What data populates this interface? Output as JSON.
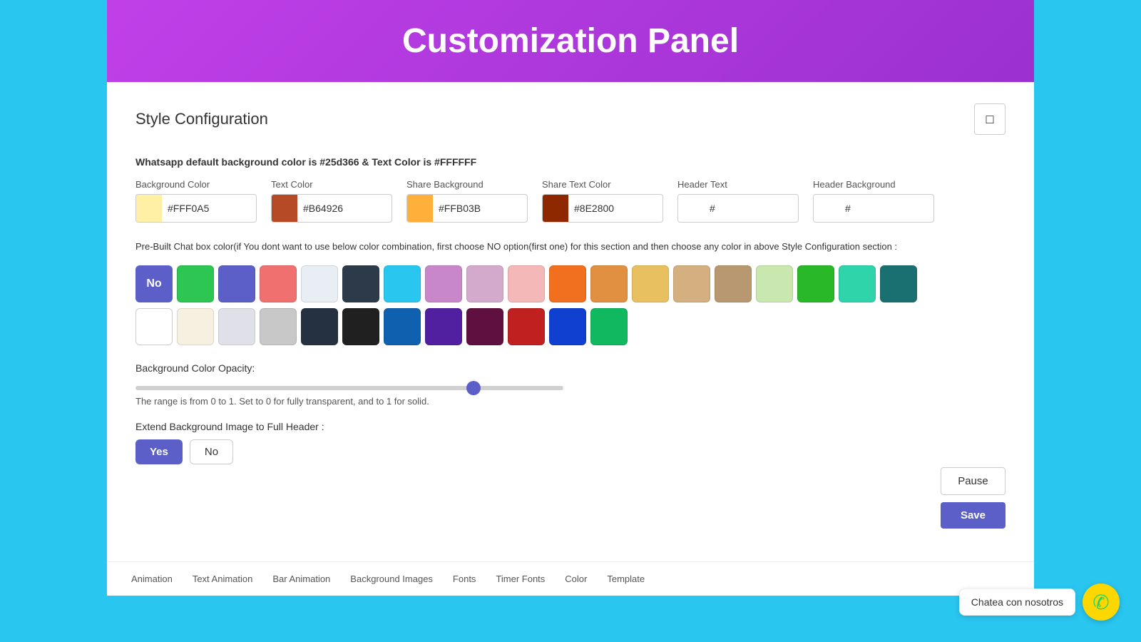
{
  "header": {
    "title": "Customization Panel",
    "bg_color": "#C040E8"
  },
  "panel": {
    "title": "Style Configuration",
    "device_icon": "□",
    "info_text": "Whatsapp default background color is #25d366 & Text Color is #FFFFFF",
    "fields": [
      {
        "label": "Background Color",
        "value": "#FFF0A5",
        "swatch": "#FFF0A5"
      },
      {
        "label": "Text Color",
        "value": "#B64926",
        "swatch": "#B64926"
      },
      {
        "label": "Share Background",
        "value": "#FFB03B",
        "swatch": "#FFB03B"
      },
      {
        "label": "Share Text Color",
        "value": "#8E2800",
        "swatch": "#8E2800"
      },
      {
        "label": "Header Text",
        "value": "#",
        "swatch": "#FFFFFF"
      },
      {
        "label": "Header Background",
        "value": "#",
        "swatch": "#FFFFFF"
      }
    ],
    "prebuilt_desc": "Pre-Built Chat box color(if You dont want to use below color combination, first choose NO option(first one) for this section and then choose any color in above Style Configuration section :",
    "swatches_row1": [
      {
        "color": "no",
        "label": "No"
      },
      {
        "color": "#2DC653"
      },
      {
        "color": "#5B5FC7"
      },
      {
        "color": "#F07070"
      },
      {
        "color": "#E8EEF4"
      },
      {
        "color": "#2D3A4A"
      },
      {
        "color": "#29C6F0"
      },
      {
        "color": "#C887C8"
      },
      {
        "color": "#D4AACC"
      },
      {
        "color": "#F5B8B8"
      },
      {
        "color": "#F07020"
      },
      {
        "color": "#E09040"
      },
      {
        "color": "#E8C060"
      },
      {
        "color": "#D4B080"
      },
      {
        "color": "#B89870"
      },
      {
        "color": "#C8E8B0"
      },
      {
        "color": "#28B828"
      },
      {
        "color": "#30D4AA"
      },
      {
        "color": "#1A7070"
      }
    ],
    "swatches_row2": [
      {
        "color": "#FFFFFF"
      },
      {
        "color": "#F5F0E0"
      },
      {
        "color": "#E0E0E8"
      },
      {
        "color": "#C8C8C8"
      },
      {
        "color": "#253040"
      },
      {
        "color": "#202020"
      },
      {
        "color": "#1060B0"
      },
      {
        "color": "#5020A0"
      },
      {
        "color": "#601040"
      },
      {
        "color": "#C02020"
      },
      {
        "color": "#1040D0"
      },
      {
        "color": "#10B860"
      }
    ],
    "opacity_label": "Background Color Opacity:",
    "opacity_value": 0.8,
    "opacity_hint": "The range is from 0 to 1. Set to 0 for fully transparent, and to 1 for solid.",
    "extend_label": "Extend Background Image to Full Header :",
    "yes_label": "Yes",
    "no_label": "No",
    "pause_label": "Pause",
    "save_label": "Save"
  },
  "bottom_nav": {
    "items": [
      "Animation",
      "Text Animation",
      "Bar Animation",
      "Background Images",
      "Fonts",
      "Timer Fonts",
      "Color",
      "Template"
    ]
  },
  "chat_widget": {
    "tooltip": "Chatea con nosotros",
    "icon": "💬"
  }
}
